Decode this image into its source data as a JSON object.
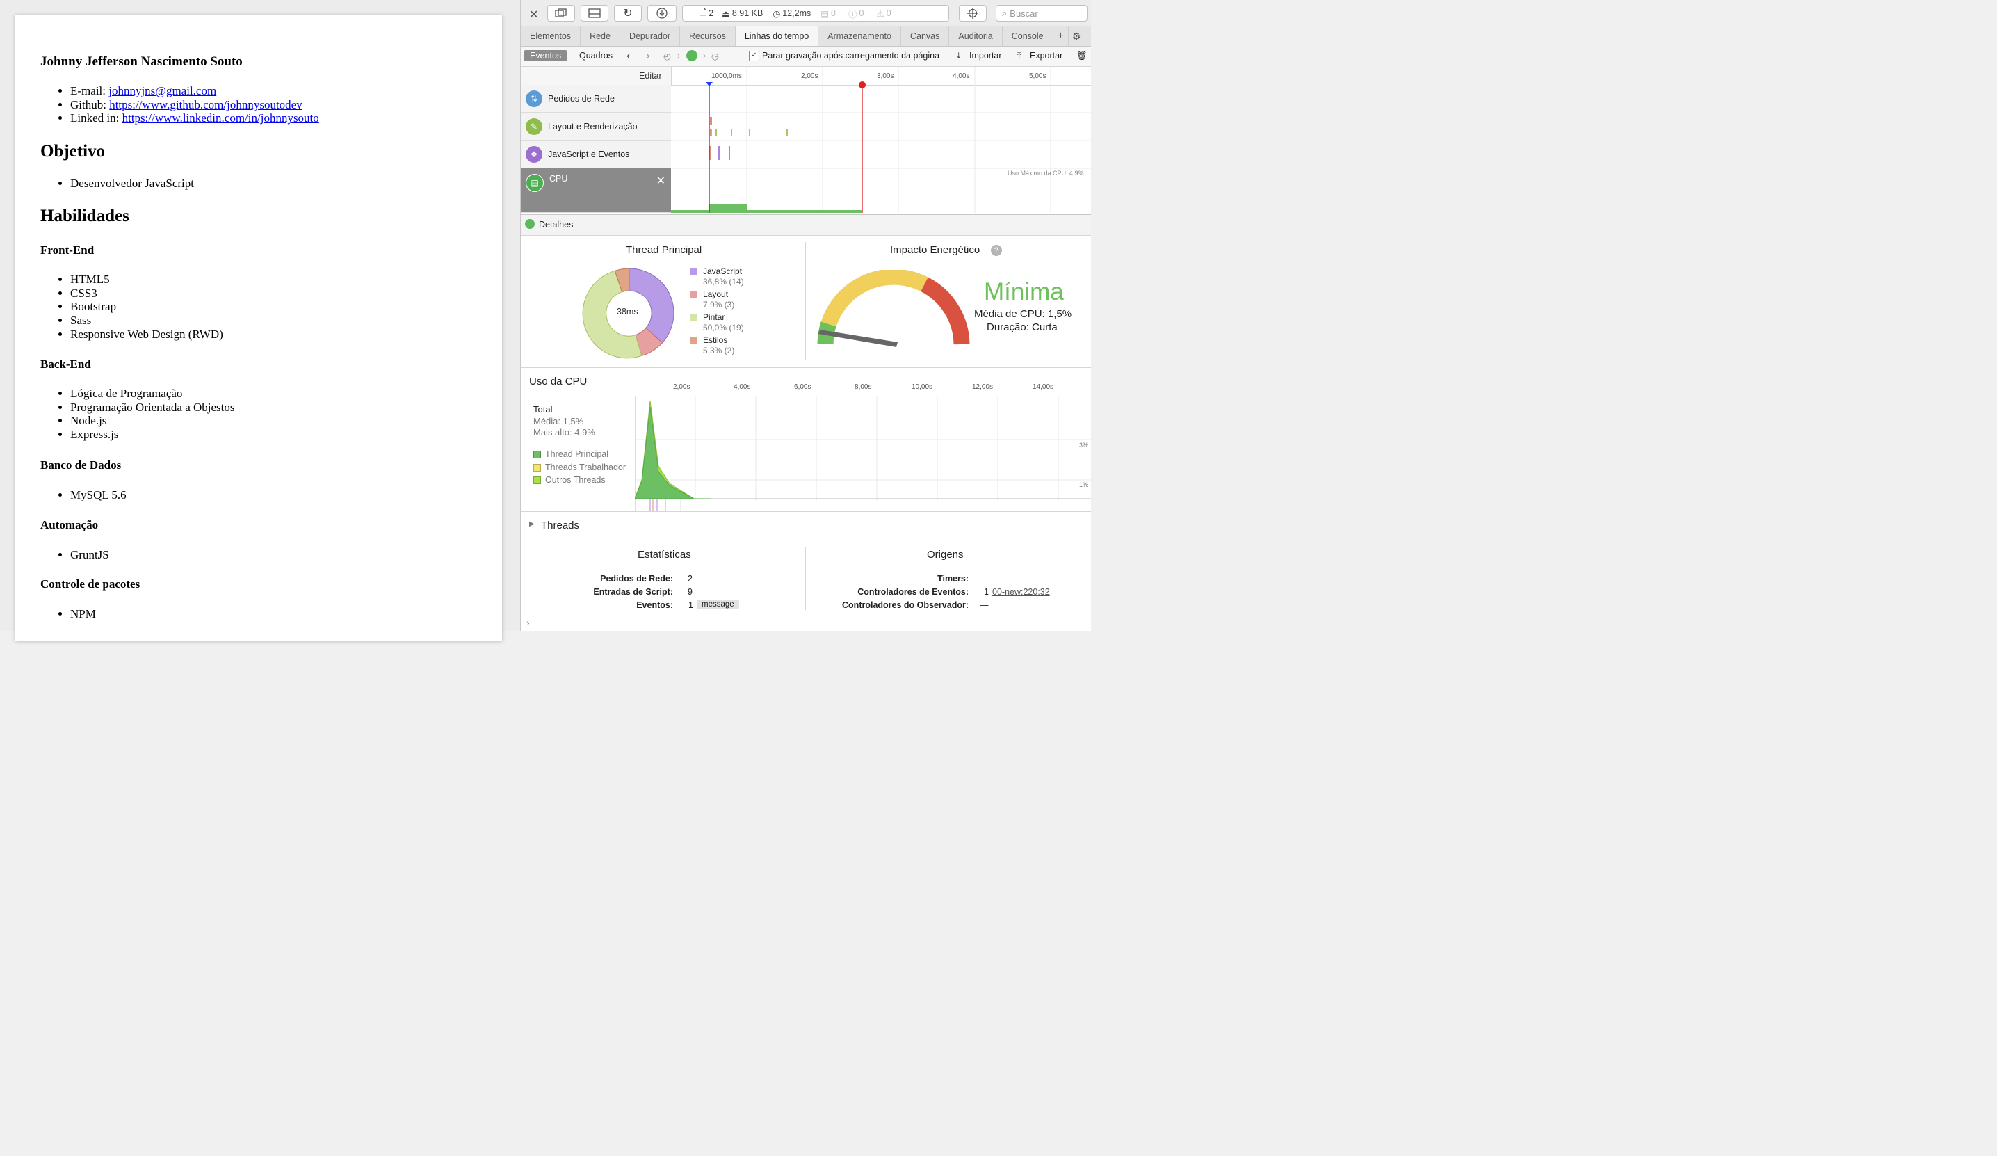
{
  "resume": {
    "name": "Johnny Jefferson Nascimento Souto",
    "contacts": [
      {
        "label": "E-mail: ",
        "link": "johnnyjns@gmail.com"
      },
      {
        "label": "Github: ",
        "link": "https://www.github.com/johnnysoutodev"
      },
      {
        "label": "Linked in: ",
        "link": "https://www.linkedin.com/in/johnnysouto"
      }
    ],
    "objective_title": "Objetivo",
    "objective_items": [
      "Desenvolvedor JavaScript"
    ],
    "skills_title": "Habilidades",
    "frontend_title": "Front-End",
    "frontend_items": [
      "HTML5",
      "CSS3",
      "Bootstrap",
      "Sass",
      "Responsive Web Design (RWD)"
    ],
    "backend_title": "Back-End",
    "backend_items": [
      "Lógica de Programação",
      "Programação Orientada a Objestos",
      "Node.js",
      "Express.js"
    ],
    "db_title": "Banco de Dados",
    "db_items": [
      "MySQL 5.6"
    ],
    "automation_title": "Automação",
    "automation_items": [
      "GruntJS"
    ],
    "packages_title": "Controle de pacotes",
    "packages_items": [
      "NPM"
    ]
  },
  "toolbar": {
    "resources_count": "2",
    "size": "8,91 KB",
    "time": "12,2ms",
    "messages": "0",
    "errors": "0",
    "warnings": "0",
    "search_placeholder": "Buscar"
  },
  "tabs": [
    "Elementos",
    "Rede",
    "Depurador",
    "Recursos",
    "Linhas do tempo",
    "Armazenamento",
    "Canvas",
    "Auditoria",
    "Console"
  ],
  "active_tab": "Linhas do tempo",
  "subbar": {
    "events": "Eventos",
    "frames": "Quadros",
    "stop_recording": "Parar gravação após carregamento da página",
    "import": "Importar",
    "export": "Exportar"
  },
  "ruler": {
    "edit": "Editar",
    "ticks": [
      "1000,0ms",
      "2,00s",
      "3,00s",
      "4,00s",
      "5,00s"
    ]
  },
  "timeline_rows": [
    {
      "label": "Pedidos de Rede",
      "color": "#5b9bd5"
    },
    {
      "label": "Layout e Renderização",
      "color": "#8fbc4a"
    },
    {
      "label": "JavaScript e Eventos",
      "color": "#9b6fd0"
    },
    {
      "label": "CPU",
      "color": "#4caf50"
    }
  ],
  "cpu_max_label": "Uso Máximo da CPU: 4,9%",
  "details_label": "Detalhes",
  "thread_principal": {
    "title": "Thread Principal",
    "center": "38ms",
    "legend": [
      {
        "name": "JavaScript",
        "stat": "36,8% (14)",
        "color": "#b89be6"
      },
      {
        "name": "Layout",
        "stat": "7,9% (3)",
        "color": "#e6a0a0"
      },
      {
        "name": "Pintar",
        "stat": "50,0% (19)",
        "color": "#d5e4a7"
      },
      {
        "name": "Estilos",
        "stat": "5,3% (2)",
        "color": "#e0a585"
      }
    ]
  },
  "energy": {
    "title": "Impacto Energético",
    "level": "Mínima",
    "avg": "Média de CPU: 1,5%",
    "duration": "Duração: Curta"
  },
  "cpu_usage": {
    "title": "Uso da CPU",
    "ticks": [
      "2,00s",
      "4,00s",
      "6,00s",
      "8,00s",
      "10,00s",
      "12,00s",
      "14,00s"
    ],
    "total": "Total",
    "avg": "Média: 1,5%",
    "max": "Mais alto: 4,9%",
    "legend": [
      {
        "name": "Thread Principal",
        "color": "#6cc063"
      },
      {
        "name": "Threads Trabalhador",
        "color": "#f1e86b"
      },
      {
        "name": "Outros Threads",
        "color": "#a8e04a"
      }
    ],
    "y3": "3%",
    "y1": "1%"
  },
  "threads_label": "Threads",
  "stats": {
    "title": "Estatísticas",
    "rows": [
      {
        "label": "Pedidos de Rede:",
        "value": "2"
      },
      {
        "label": "Entradas de Script:",
        "value": "9"
      },
      {
        "label": "Eventos:",
        "value": "1",
        "badge": "message"
      }
    ]
  },
  "origins": {
    "title": "Origens",
    "rows": [
      {
        "label": "Timers:",
        "value": "—"
      },
      {
        "label": "Controladores de Eventos:",
        "value": "1",
        "link": "00-new:220:32"
      },
      {
        "label": "Controladores do Observador:",
        "value": "—"
      }
    ]
  }
}
